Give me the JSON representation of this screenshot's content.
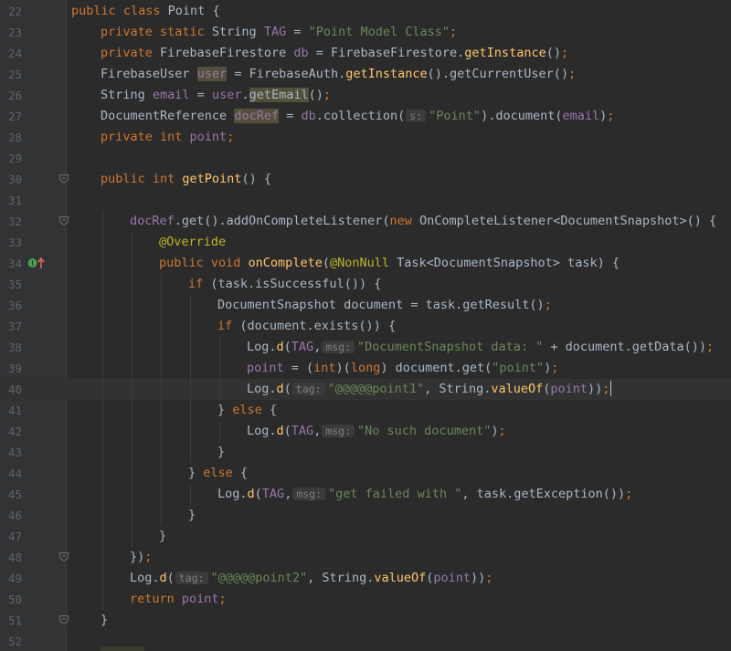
{
  "editor": {
    "language": "Java",
    "current_line": 40,
    "colors": {
      "background": "#2b2b2b",
      "gutter": "#313335",
      "keyword": "#cc7832",
      "string": "#6a8759",
      "method": "#ffc66d",
      "field": "#9876aa",
      "annotation": "#bbb529",
      "text": "#a9b7c6",
      "line_number": "#606366"
    },
    "lines": [
      {
        "n": "22",
        "indent": 0,
        "parts": [
          {
            "t": "public class ",
            "c": "kw"
          },
          {
            "t": "Point {"
          }
        ]
      },
      {
        "n": "23",
        "indent": 1,
        "parts": [
          {
            "t": "private static ",
            "c": "kw"
          },
          {
            "t": "String "
          },
          {
            "t": "TAG",
            "c": "fd"
          },
          {
            "t": " = "
          },
          {
            "t": "\"Point Model Class\"",
            "c": "st"
          },
          {
            "t": ";",
            "c": "kw"
          }
        ]
      },
      {
        "n": "24",
        "indent": 1,
        "parts": [
          {
            "t": "private ",
            "c": "kw"
          },
          {
            "t": "FirebaseFirestore "
          },
          {
            "t": "db",
            "c": "fd"
          },
          {
            "t": " = FirebaseFirestore."
          },
          {
            "t": "getInstance",
            "c": "fn"
          },
          {
            "t": "()"
          },
          {
            "t": ";",
            "c": "kw"
          }
        ]
      },
      {
        "n": "25",
        "indent": 1,
        "parts": [
          {
            "t": "FirebaseUser "
          },
          {
            "t": "user",
            "c": "fd hl"
          },
          {
            "t": " = FirebaseAuth."
          },
          {
            "t": "getInstance",
            "c": "fn"
          },
          {
            "t": "().getCurrentUser()"
          },
          {
            "t": ";",
            "c": "kw"
          }
        ]
      },
      {
        "n": "26",
        "indent": 1,
        "parts": [
          {
            "t": "String "
          },
          {
            "t": "email",
            "c": "fd"
          },
          {
            "t": " = "
          },
          {
            "t": "user",
            "c": "fd"
          },
          {
            "t": "."
          },
          {
            "t": "getEmail",
            "c": "hl"
          },
          {
            "t": "()"
          },
          {
            "t": ";",
            "c": "kw"
          }
        ]
      },
      {
        "n": "27",
        "indent": 1,
        "parts": [
          {
            "t": "DocumentReference "
          },
          {
            "t": "docRef",
            "c": "fd hl"
          },
          {
            "t": " = "
          },
          {
            "t": "db",
            "c": "fd"
          },
          {
            "t": ".collection("
          },
          {
            "t": "s:",
            "c": "hint"
          },
          {
            "t": "\"Point\"",
            "c": "st"
          },
          {
            "t": ").document("
          },
          {
            "t": "email",
            "c": "fd"
          },
          {
            "t": ")"
          },
          {
            "t": ";",
            "c": "kw"
          }
        ]
      },
      {
        "n": "28",
        "indent": 1,
        "parts": [
          {
            "t": "private int ",
            "c": "kw"
          },
          {
            "t": "point",
            "c": "fd"
          },
          {
            "t": ";",
            "c": "kw"
          }
        ]
      },
      {
        "n": "29",
        "indent": 0,
        "parts": []
      },
      {
        "n": "30",
        "indent": 1,
        "fold": true,
        "parts": [
          {
            "t": "public int ",
            "c": "kw"
          },
          {
            "t": "getPoint",
            "c": "fn"
          },
          {
            "t": "() {"
          }
        ]
      },
      {
        "n": "31",
        "indent": 0,
        "parts": []
      },
      {
        "n": "32",
        "indent": 2,
        "fold": true,
        "parts": [
          {
            "t": "docRef",
            "c": "fd"
          },
          {
            "t": ".get().addOnCompleteListener("
          },
          {
            "t": "new ",
            "c": "kw"
          },
          {
            "t": "OnCompleteListener<DocumentSnapshot>() {"
          }
        ]
      },
      {
        "n": "33",
        "indent": 3,
        "parts": [
          {
            "t": "@Override",
            "c": "an"
          }
        ]
      },
      {
        "n": "34",
        "indent": 3,
        "marker": true,
        "parts": [
          {
            "t": "public void ",
            "c": "kw"
          },
          {
            "t": "onComplete",
            "c": "fn"
          },
          {
            "t": "("
          },
          {
            "t": "@NonNull ",
            "c": "an"
          },
          {
            "t": "Task<DocumentSnapshot> task) {"
          }
        ]
      },
      {
        "n": "35",
        "indent": 4,
        "parts": [
          {
            "t": "if ",
            "c": "kw"
          },
          {
            "t": "(task.isSuccessful()) {"
          }
        ]
      },
      {
        "n": "36",
        "indent": 5,
        "parts": [
          {
            "t": "DocumentSnapshot document = task.getResult()"
          },
          {
            "t": ";",
            "c": "kw"
          }
        ]
      },
      {
        "n": "37",
        "indent": 5,
        "parts": [
          {
            "t": "if ",
            "c": "kw"
          },
          {
            "t": "(document.exists()) {"
          }
        ]
      },
      {
        "n": "38",
        "indent": 6,
        "parts": [
          {
            "t": "Log."
          },
          {
            "t": "d",
            "c": "fn"
          },
          {
            "t": "("
          },
          {
            "t": "TAG",
            "c": "fd"
          },
          {
            "t": ","
          },
          {
            "t": "msg:",
            "c": "hint"
          },
          {
            "t": "\"DocumentSnapshot data: \"",
            "c": "st"
          },
          {
            "t": " + document.getData())"
          },
          {
            "t": ";",
            "c": "kw"
          }
        ]
      },
      {
        "n": "39",
        "indent": 6,
        "parts": [
          {
            "t": "point",
            "c": "fd"
          },
          {
            "t": " = ("
          },
          {
            "t": "int",
            "c": "kw"
          },
          {
            "t": ")("
          },
          {
            "t": "long",
            "c": "kw"
          },
          {
            "t": ") document.get("
          },
          {
            "t": "\"point\"",
            "c": "st"
          },
          {
            "t": ")"
          },
          {
            "t": ";",
            "c": "kw"
          }
        ]
      },
      {
        "n": "40",
        "indent": 6,
        "current": true,
        "parts": [
          {
            "t": "Log."
          },
          {
            "t": "d",
            "c": "fn"
          },
          {
            "t": "("
          },
          {
            "t": "tag:",
            "c": "hint"
          },
          {
            "t": "\"@@@@@point1\"",
            "c": "st"
          },
          {
            "t": ", String."
          },
          {
            "t": "valueOf",
            "c": "fn"
          },
          {
            "t": "("
          },
          {
            "t": "point",
            "c": "fd"
          },
          {
            "t": "))"
          },
          {
            "t": ";",
            "c": "kw"
          },
          {
            "t": "",
            "c": "caret"
          }
        ]
      },
      {
        "n": "41",
        "indent": 5,
        "parts": [
          {
            "t": "} "
          },
          {
            "t": "else ",
            "c": "kw"
          },
          {
            "t": "{"
          }
        ]
      },
      {
        "n": "42",
        "indent": 6,
        "parts": [
          {
            "t": "Log."
          },
          {
            "t": "d",
            "c": "fn"
          },
          {
            "t": "("
          },
          {
            "t": "TAG",
            "c": "fd"
          },
          {
            "t": ","
          },
          {
            "t": "msg:",
            "c": "hint"
          },
          {
            "t": "\"No such document\"",
            "c": "st"
          },
          {
            "t": ")"
          },
          {
            "t": ";",
            "c": "kw"
          }
        ]
      },
      {
        "n": "43",
        "indent": 5,
        "parts": [
          {
            "t": "}"
          }
        ]
      },
      {
        "n": "44",
        "indent": 4,
        "parts": [
          {
            "t": "} "
          },
          {
            "t": "else ",
            "c": "kw"
          },
          {
            "t": "{"
          }
        ]
      },
      {
        "n": "45",
        "indent": 5,
        "parts": [
          {
            "t": "Log."
          },
          {
            "t": "d",
            "c": "fn"
          },
          {
            "t": "("
          },
          {
            "t": "TAG",
            "c": "fd"
          },
          {
            "t": ","
          },
          {
            "t": "msg:",
            "c": "hint"
          },
          {
            "t": "\"get failed with \"",
            "c": "st"
          },
          {
            "t": ", task.getException())"
          },
          {
            "t": ";",
            "c": "kw"
          }
        ]
      },
      {
        "n": "46",
        "indent": 4,
        "parts": [
          {
            "t": "}"
          }
        ]
      },
      {
        "n": "47",
        "indent": 3,
        "parts": [
          {
            "t": "}"
          }
        ]
      },
      {
        "n": "48",
        "indent": 2,
        "fold": true,
        "parts": [
          {
            "t": "})"
          },
          {
            "t": ";",
            "c": "kw"
          }
        ]
      },
      {
        "n": "49",
        "indent": 2,
        "parts": [
          {
            "t": "Log."
          },
          {
            "t": "d",
            "c": "fn"
          },
          {
            "t": "("
          },
          {
            "t": "tag:",
            "c": "hint"
          },
          {
            "t": "\"@@@@@point2\"",
            "c": "st"
          },
          {
            "t": ", String."
          },
          {
            "t": "valueOf",
            "c": "fn"
          },
          {
            "t": "("
          },
          {
            "t": "point",
            "c": "fd"
          },
          {
            "t": "))"
          },
          {
            "t": ";",
            "c": "kw"
          }
        ]
      },
      {
        "n": "50",
        "indent": 2,
        "parts": [
          {
            "t": "return ",
            "c": "kw"
          },
          {
            "t": "point",
            "c": "fd"
          },
          {
            "t": ";",
            "c": "kw"
          }
        ]
      },
      {
        "n": "51",
        "indent": 1,
        "fold": true,
        "parts": [
          {
            "t": "}"
          }
        ]
      },
      {
        "n": "52",
        "indent": 0,
        "parts": []
      }
    ]
  }
}
